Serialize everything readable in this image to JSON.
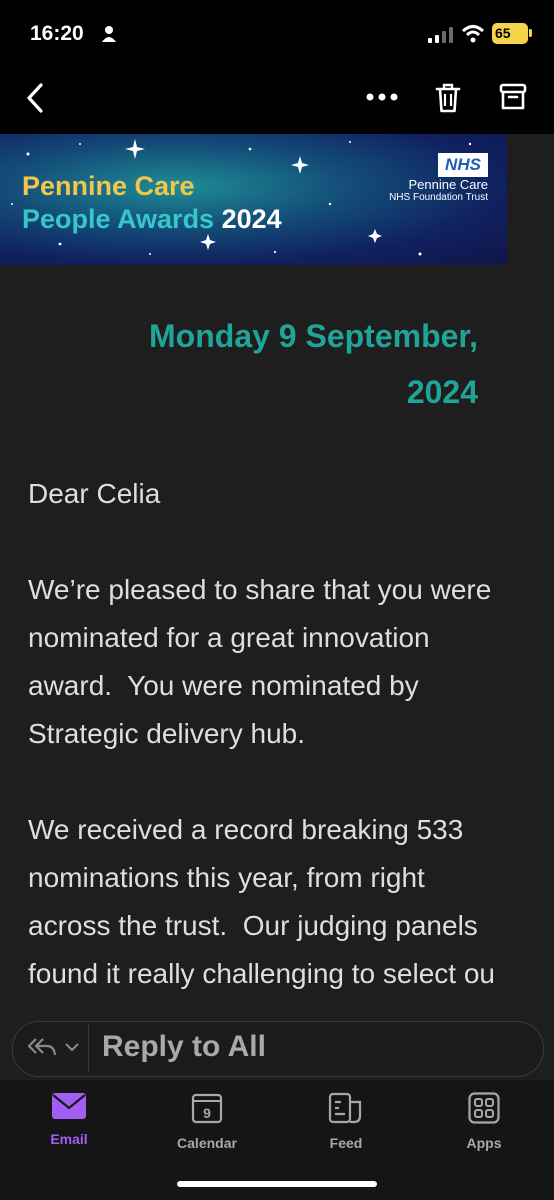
{
  "status_bar": {
    "time": "16:20",
    "battery": "65"
  },
  "banner": {
    "line1": "Pennine Care",
    "line2": "People Awards",
    "year": "2024",
    "logo": "NHS",
    "org_name": "Pennine Care",
    "org_sub": "NHS Foundation Trust"
  },
  "email": {
    "date_line1": "Monday 9 September,",
    "date_line2": "2024",
    "greeting": "Dear Celia",
    "para1": [
      "We’re pleased to share that you were",
      "nominated for a great innovation",
      "award.  You were nominated by",
      "Strategic delivery hub."
    ],
    "para2": [
      "We received a record breaking 533",
      "nominations this year, from right",
      "across the trust.  Our judging panels",
      "found it really challenging to select ou"
    ]
  },
  "reply": {
    "label": "Reply to All"
  },
  "tabs": [
    {
      "label": "Email",
      "icon": "email-icon",
      "active": true
    },
    {
      "label": "Calendar",
      "icon": "calendar-icon",
      "day": "9"
    },
    {
      "label": "Feed",
      "icon": "feed-icon"
    },
    {
      "label": "Apps",
      "icon": "apps-icon"
    }
  ],
  "colors": {
    "accent": "#a25ef2",
    "date_teal": "#1fa49a",
    "banner_gold": "#f3c64a"
  }
}
